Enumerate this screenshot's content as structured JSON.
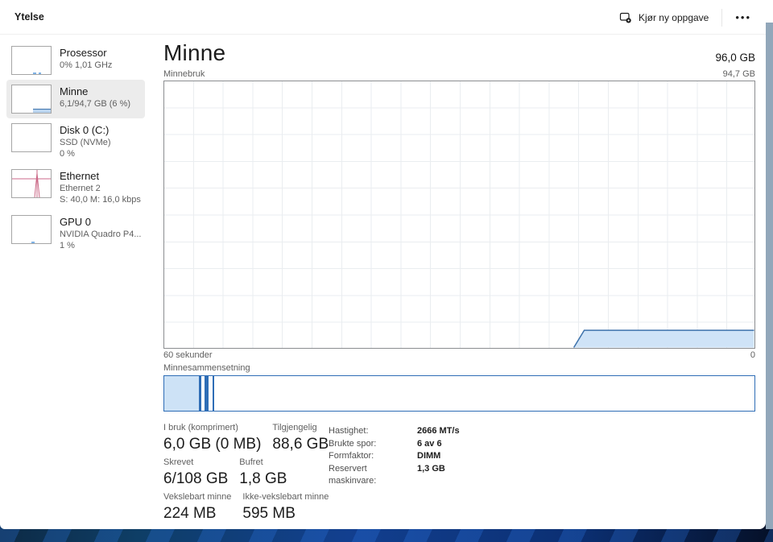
{
  "header": {
    "title": "Ytelse",
    "run_new_task_label": "Kjør ny oppgave",
    "more_label": "•••"
  },
  "sidebar": {
    "items": [
      {
        "name": "Prosessor",
        "lines": [
          "0% 1,01 GHz"
        ],
        "selected": false,
        "thumb": "cpu-mini-chart"
      },
      {
        "name": "Minne",
        "lines": [
          "6,1/94,7 GB (6 %)"
        ],
        "selected": true,
        "thumb": "memory-mini-chart"
      },
      {
        "name": "Disk 0 (C:)",
        "lines": [
          "SSD (NVMe)",
          "0 %"
        ],
        "selected": false,
        "thumb": "disk-mini-chart"
      },
      {
        "name": "Ethernet",
        "lines": [
          "Ethernet 2",
          "S: 40,0 M: 16,0 kbps"
        ],
        "selected": false,
        "thumb": "ethernet-mini-chart"
      },
      {
        "name": "GPU 0",
        "lines": [
          "NVIDIA Quadro P4...",
          "1 %"
        ],
        "selected": false,
        "thumb": "gpu-mini-chart"
      }
    ]
  },
  "main": {
    "title": "Minne",
    "total": "96,0 GB",
    "chart": {
      "label": "Minnebruk",
      "max_label": "94,7 GB",
      "left_label": "60 sekunder",
      "right_label": "0"
    },
    "composition_label": "Minnesammensetning",
    "stats": [
      {
        "label": "I bruk (komprimert)",
        "value": "6,0 GB (0 MB)"
      },
      {
        "label": "Tilgjengelig",
        "value": "88,6 GB"
      },
      {
        "label": "Skrevet",
        "value": "6/108 GB"
      },
      {
        "label": "Bufret",
        "value": "1,8 GB"
      },
      {
        "label": "Vekslebart minne",
        "value": "224 MB"
      },
      {
        "label": "Ikke-vekslebart minne",
        "value": "595 MB"
      }
    ],
    "details": [
      {
        "label": "Hastighet:",
        "value": "2666 MT/s"
      },
      {
        "label": "Brukte spor:",
        "value": "6 av 6"
      },
      {
        "label": "Formfaktor:",
        "value": "DIMM"
      },
      {
        "label": "Reservert maskinvare:",
        "value": "1,3 GB"
      }
    ]
  },
  "chart_data": {
    "type": "area",
    "title": "Minnebruk",
    "ylim_gb": [
      0,
      94.7
    ],
    "x_window_seconds": 60,
    "series": [
      {
        "name": "Minnebruk (GB)",
        "note": "flat at ~6,0 GB for newest ~30% of window; no data before that",
        "plateau_value_gb": 6.0
      }
    ]
  },
  "colors": {
    "accent_blue": "#2e6db6",
    "chart_fill": "#cfe3f7",
    "chart_line": "#3d72ab",
    "ethernet_pink": "#cb6987",
    "selected_bg": "#ececec",
    "wallpaper_navy": "#0d2f66"
  }
}
